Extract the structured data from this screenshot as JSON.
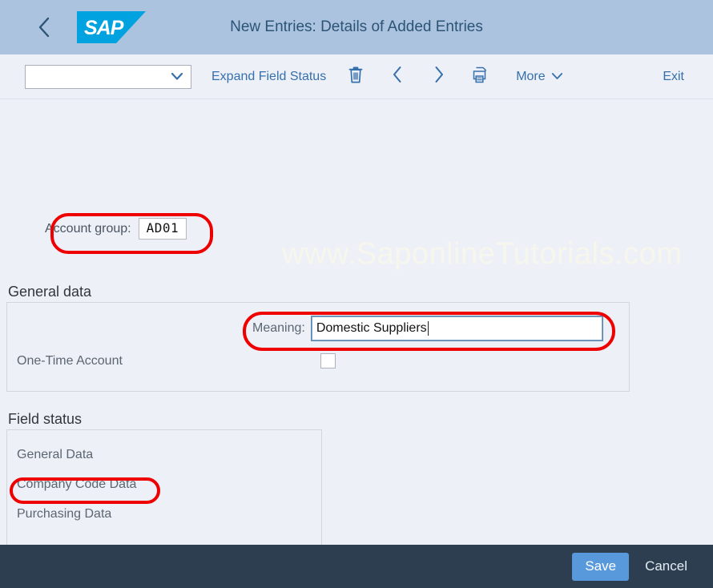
{
  "header": {
    "back_icon": "chevron-left-icon",
    "logo_text": "SAP",
    "title": "New Entries: Details of Added Entries"
  },
  "toolbar": {
    "variant_value": "",
    "variant_placeholder": "",
    "dropdown_icon": "chevron-down-icon",
    "expand_field_status_label": "Expand Field Status",
    "delete_icon": "trash-icon",
    "previous_icon": "chevron-left-icon",
    "next_icon": "chevron-right-icon",
    "print_icon": "printer-icon",
    "more_label": "More",
    "more_icon": "chevron-down-icon",
    "exit_label": "Exit"
  },
  "watermark": "www.SaponlineTutorials.com",
  "account_group": {
    "label": "Account group:",
    "value": "AD01"
  },
  "general_data": {
    "title": "General data",
    "meaning_label": "Meaning:",
    "meaning_value": "Domestic Suppliers",
    "one_time_account_label": "One-Time Account",
    "one_time_account_checked": false
  },
  "field_status": {
    "title": "Field status",
    "items": [
      {
        "label": "General Data"
      },
      {
        "label": "Company Code Data"
      },
      {
        "label": "Purchasing Data"
      }
    ]
  },
  "footer": {
    "save_label": "Save",
    "cancel_label": "Cancel"
  },
  "colors": {
    "header_bg": "#abc3de",
    "page_bg": "#eef0f8",
    "accent_link": "#3570ac",
    "sap_blue": "#00a2e0",
    "footer_bg": "#2c3e50",
    "save_button": "#5899dc",
    "annotation_red": "#ee0000"
  }
}
